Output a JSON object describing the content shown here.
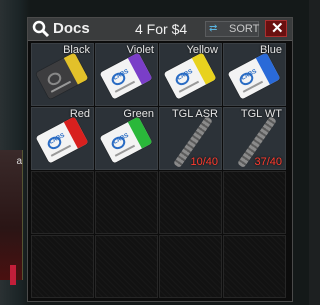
{
  "window": {
    "title": "Docs",
    "price": "4 For $4",
    "sort_label": "SORT",
    "close_symbol": "✕"
  },
  "background": {
    "side_label": "a"
  },
  "items": [
    {
      "name": "Black",
      "type": "keycard",
      "badge": "",
      "color": "#e2c12a",
      "dark": true
    },
    {
      "name": "Violet",
      "type": "keycard",
      "badge": "LABS",
      "color": "#7a3ec8",
      "dark": false
    },
    {
      "name": "Yellow",
      "type": "keycard",
      "badge": "LABS",
      "color": "#e8d21e",
      "dark": false
    },
    {
      "name": "Blue",
      "type": "keycard",
      "badge": "LABS",
      "color": "#2a6ad8",
      "dark": false
    },
    {
      "name": "Red",
      "type": "keycard",
      "badge": "LABS",
      "color": "#d8201e",
      "dark": false
    },
    {
      "name": "Green",
      "type": "keycard",
      "badge": "LABS",
      "color": "#2ab83a",
      "dark": false
    },
    {
      "name": "TGL ASR",
      "type": "silencer",
      "count": "10/40"
    },
    {
      "name": "TGL WT",
      "type": "silencer",
      "count": "37/40"
    }
  ],
  "icons": {
    "search": "search-icon",
    "sort": "sort-icon",
    "close": "close-icon"
  }
}
